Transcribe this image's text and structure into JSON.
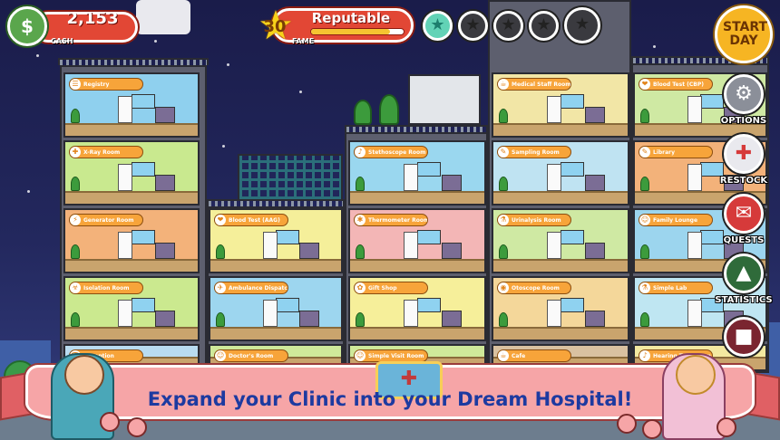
{
  "hud": {
    "cash_value": "2,153",
    "cash_caption": "CASH",
    "fame_level": "30",
    "fame_caption": "FAME",
    "fame_title": "Reputable",
    "fame_progress": 0.85,
    "hospital_stars": {
      "earned": 1,
      "total": 5
    }
  },
  "buttons": {
    "start_day": "START DAY",
    "options": "OPTIONS",
    "restock": "RESTOCK",
    "quests": "QUESTS",
    "statistics": "STATISTICS"
  },
  "rooms": [
    "Registry",
    "X-Ray Room",
    "Generator Room",
    "Isolation Room",
    "Reception",
    "Blood Test (AAG)",
    "Ambulance Dispatch",
    "Doctor's Room",
    "Stethoscope Room",
    "Thermometer Room",
    "Gift Shop",
    "Simple Visit Room",
    "Medical Staff Room",
    "Sampling Room",
    "Urinalysis Room",
    "Otoscope Room",
    "Cafe",
    "Blood Test (CBP)",
    "Library",
    "Family Lounge",
    "Simple Lab",
    "Hearing Test Room"
  ],
  "banner": {
    "text": "Expand your Clinic into your Dream Hospital!"
  },
  "colors": {
    "label_orange": "#f7a43a",
    "hud_red": "#e24735",
    "banner_text": "#1d3aa0",
    "night_sky": "#1a1c4a"
  }
}
